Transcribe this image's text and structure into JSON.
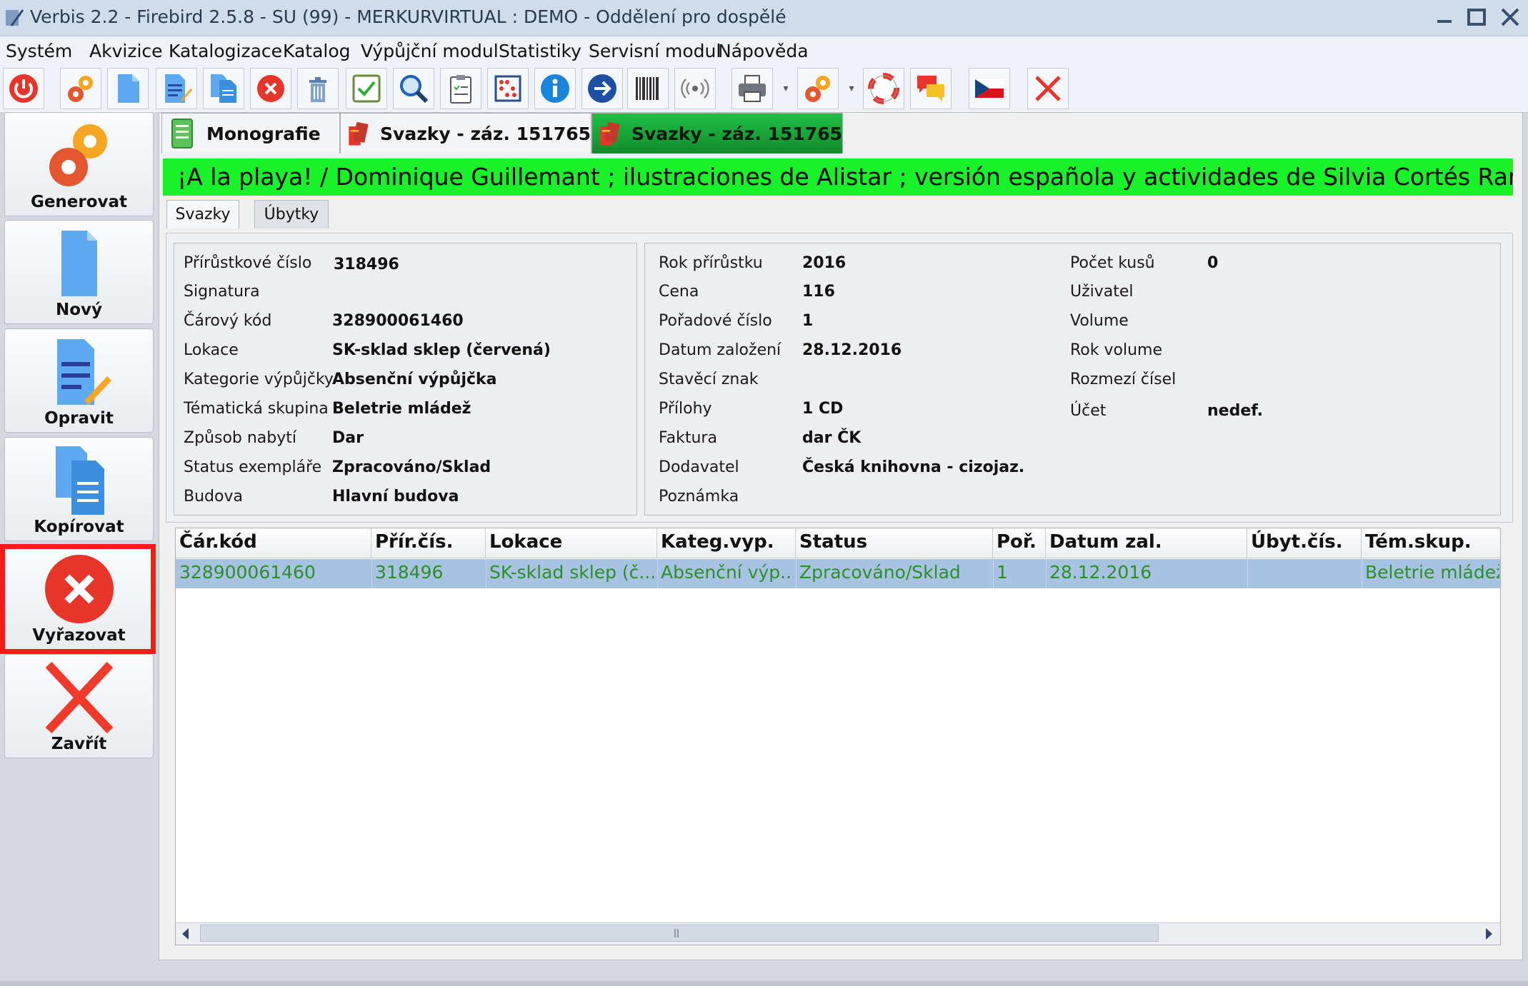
{
  "window": {
    "title": "Verbis 2.2 - Firebird 2.5.8 - SU (99) - MERKURVIRTUAL : DEMO - Oddělení pro dospělé"
  },
  "menu": [
    "Systém",
    "Akvizice",
    "Katalogizace",
    "Katalog",
    "Výpůjční modul",
    "Statistiky",
    "Servisní modul",
    "Nápověda"
  ],
  "toolbar": {
    "icons": [
      "power-icon",
      "gears-icon",
      "new-document-icon",
      "edit-document-icon",
      "copy-document-icon",
      "delete-red-icon",
      "trash-icon",
      "check-icon",
      "search-icon",
      "clipboard-icon",
      "abacus-icon",
      "info-icon",
      "arrow-right-icon",
      "barcode-icon",
      "rfid-icon",
      "printer-icon",
      "gears-dropdown-icon",
      "lifebuoy-icon",
      "chat-icon",
      "czech-flag-icon",
      "close-icon"
    ]
  },
  "sidebar": {
    "buttons": [
      {
        "label": "Generovat",
        "icon": "gears-icon"
      },
      {
        "label": "Nový",
        "icon": "new-document-icon"
      },
      {
        "label": "Opravit",
        "icon": "edit-document-icon"
      },
      {
        "label": "Kopírovat",
        "icon": "copy-document-icon"
      },
      {
        "label": "Vyřazovat",
        "icon": "delete-red-icon"
      },
      {
        "label": "Zavřít",
        "icon": "close-icon"
      }
    ]
  },
  "tabs": [
    {
      "label": "Monografie",
      "active": false
    },
    {
      "label": "Svazky - záz. 151765",
      "active": false
    },
    {
      "label": "Svazky - záz. 151765",
      "active": true
    }
  ],
  "record_title": "¡A la playa! / Dominique Guillemant ; ilustraciones de Alistar ; versión española y actividades de Silvia Cortés Rami",
  "subtabs": [
    "Svazky",
    "Úbytky"
  ],
  "details": {
    "left": [
      {
        "label": "Přírůstkové číslo",
        "value": "318496"
      },
      {
        "label": "Signatura",
        "value": ""
      },
      {
        "label": "Čárový kód",
        "value": "328900061460"
      },
      {
        "label": "Lokace",
        "value": "SK-sklad sklep (červená)"
      },
      {
        "label": "Kategorie výpůjčky",
        "value": "Absenční výpůjčka"
      },
      {
        "label": "Tématická skupina",
        "value": "Beletrie mládež"
      },
      {
        "label": "Způsob nabytí",
        "value": "Dar"
      },
      {
        "label": "Status exempláře",
        "value": "Zpracováno/Sklad"
      },
      {
        "label": "Budova",
        "value": "Hlavní budova"
      }
    ],
    "middle": [
      {
        "label": "Rok přírůstku",
        "value": "2016"
      },
      {
        "label": "Cena",
        "value": "116"
      },
      {
        "label": "Pořadové číslo",
        "value": "1"
      },
      {
        "label": "Datum založení",
        "value": "28.12.2016"
      },
      {
        "label": "Stavěcí znak",
        "value": ""
      },
      {
        "label": "Přílohy",
        "value": "1 CD"
      },
      {
        "label": "Faktura",
        "value": "dar ČK"
      },
      {
        "label": "Dodavatel",
        "value": "Česká knihovna - cizojaz."
      },
      {
        "label": "Poznámka",
        "value": ""
      }
    ],
    "right": [
      {
        "label": "Počet kusů",
        "value": "0"
      },
      {
        "label": "Uživatel",
        "value": ""
      },
      {
        "label": "Volume",
        "value": ""
      },
      {
        "label": "Rok volume",
        "value": ""
      },
      {
        "label": "Rozmezí čísel",
        "value": ""
      },
      {
        "label": "Účet",
        "value": "nedef."
      }
    ]
  },
  "grid": {
    "columns": [
      "Čár.kód",
      "Přír.čís.",
      "Lokace",
      "Kateg.vyp.",
      "Status",
      "Poř.",
      "Datum zal.",
      "Úbyt.čís.",
      "Tém.skup."
    ],
    "rows": [
      [
        "328900061460",
        "318496",
        "SK-sklad sklep (č...",
        "Absenční výp...",
        "Zpracováno/Sklad",
        "1",
        "28.12.2016",
        "",
        "Beletrie mládež"
      ]
    ]
  }
}
